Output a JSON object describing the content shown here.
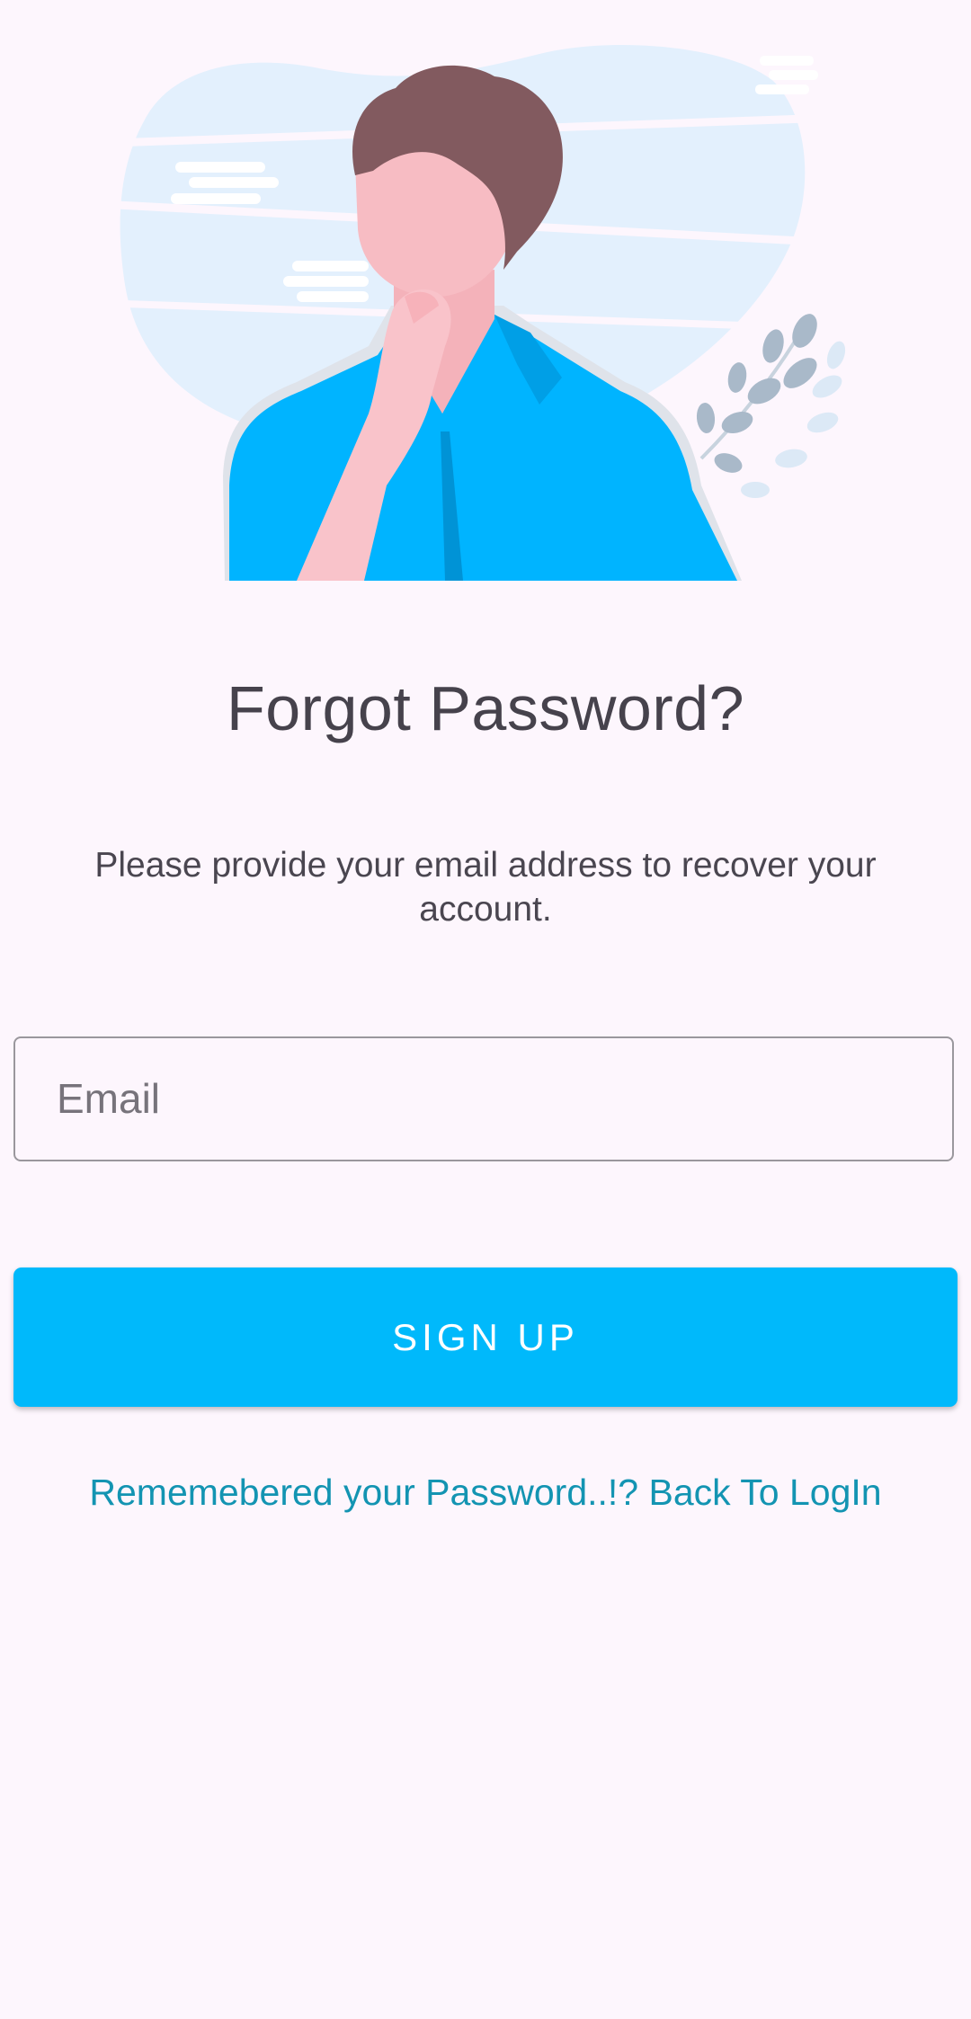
{
  "illustration": {
    "icon": "person-thinking-illustration",
    "colors": {
      "shirt": "#00b4ff",
      "skin": "#f7bcc3",
      "hair": "#825a5f",
      "background_blob": "#e3f0fd",
      "leaves": "#a9b9c9"
    }
  },
  "screen": {
    "title": "Forgot Password?",
    "subtitle": "Please provide your email address to recover your account."
  },
  "form": {
    "email_placeholder": "Email",
    "email_value": ""
  },
  "actions": {
    "submit_label": "SIGN UP",
    "back_to_login_label": "Rememebered your Password..!? Back To LogIn"
  },
  "colors": {
    "background": "#fdf6fd",
    "accent": "#00b9fb",
    "link": "#1394b2",
    "text": "#46424c"
  }
}
